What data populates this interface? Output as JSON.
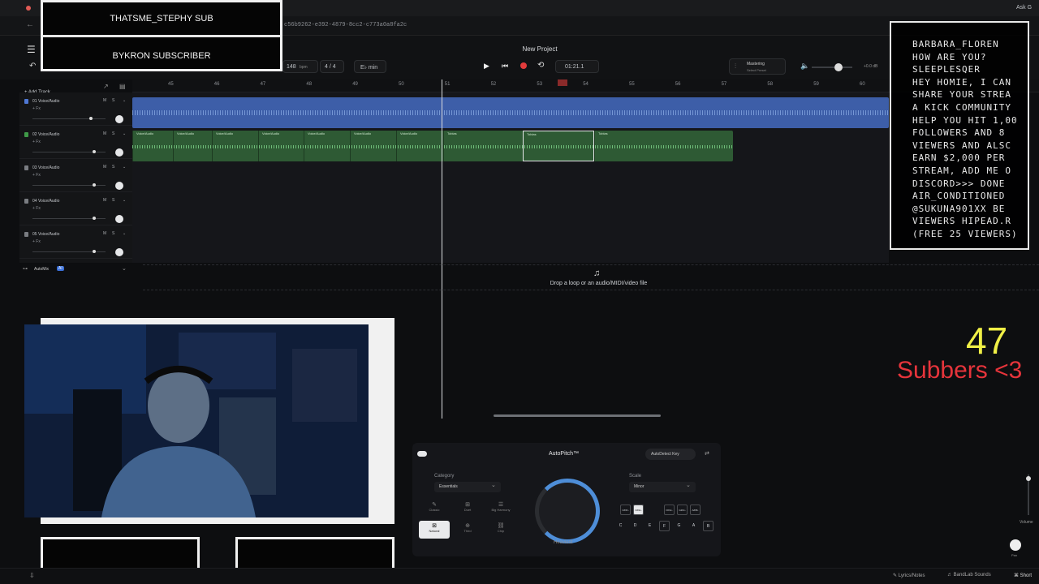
{
  "browser": {
    "url": "c56b9262-e392-4879-8cc2-c773a0a8fa2c",
    "top_right": "Ask G"
  },
  "overlay": {
    "sub_line_1": "THATSME_STEPHY SUB",
    "sub_line_2": "BYKRON SUBSCRIBER",
    "chat": [
      "BARBARA_FLOREN",
      "HOW ARE YOU?",
      "SLEEPLESQER",
      "HEY HOMIE, I CAN",
      "SHARE YOUR STREA",
      "A KICK COMMUNITY",
      "HELP YOU HIT 1,00",
      "FOLLOWERS AND 8",
      "VIEWERS AND ALSC",
      "EARN $2,000 PER",
      "STREAM, ADD ME O",
      "DISCORD>>> DONE",
      "AIR_CONDITIONED",
      "@SUKUNA901XX BE",
      "VIEWERS HIPEAD.R",
      "(FREE 25 VIEWERS)"
    ],
    "count": "47",
    "count_label": "Subbers <3"
  },
  "daw": {
    "project_title": "New Project",
    "bpm": "148",
    "bpm_unit": "bpm",
    "time_signature": "4 / 4",
    "key": "E♭ min",
    "time": "01:21.1",
    "mastering_label": "Mastering",
    "mastering_sub": "Select Preset",
    "volume_readout": "+0.0 dB",
    "add_track": "+ Add Track",
    "ruler": [
      "45",
      "46",
      "47",
      "48",
      "49",
      "50",
      "51",
      "52",
      "53",
      "54",
      "55",
      "56",
      "57",
      "58",
      "59",
      "60"
    ],
    "tracks": [
      {
        "name": "01 Voice/Audio",
        "fx": "+ Fx",
        "color": "#4f78d4"
      },
      {
        "name": "02 Voice/Audio",
        "fx": "+ Fx",
        "color": "#3f9a48"
      },
      {
        "name": "03 Voice/Audio",
        "fx": "+ Fx",
        "color": "#7a7d82"
      },
      {
        "name": "04 Voice/Audio",
        "fx": "+ Fx",
        "color": "#7a7d82"
      },
      {
        "name": "05 Voice/Audio",
        "fx": "+ Fx",
        "color": "#7a7d82"
      }
    ],
    "clip_label": "Voice/Audio",
    "clip_label_alt": "Tobias",
    "automix": "AutoMix",
    "automix_badge": "AI",
    "drop_text": "Drop a loop or an audio/MIDI/video file"
  },
  "autopitch": {
    "title": "AutoPitch™",
    "autodetect": "AutoDetect Key",
    "category_label": "Category",
    "category_value": "Essentials",
    "scale_label": "Scale",
    "scale_value": "Minor",
    "presets": [
      "Classic",
      "Duet",
      "Big Harmony",
      "Natural",
      "Third",
      "Chip"
    ],
    "knob_label": "Heaviest",
    "notes": [
      "C",
      "D",
      "E",
      "F",
      "G",
      "A",
      "B"
    ],
    "sharps": [
      "C#/D♭",
      "D#/E♭",
      "F#/G♭",
      "G#/A♭",
      "A#/B♭"
    ],
    "volume_label": "Volume",
    "pan_label": "Pan"
  },
  "bottom": {
    "lyrics": "Lyrics/Notes",
    "sounds": "BandLab Sounds",
    "shortcuts": "Short"
  }
}
